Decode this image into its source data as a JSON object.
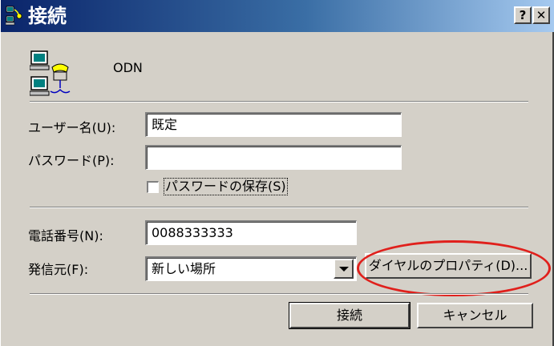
{
  "window": {
    "title": "接続",
    "help_label": "?",
    "close_label": "✕"
  },
  "connection": {
    "name": "ODN",
    "icon": "dialup-connection-icon"
  },
  "fields": {
    "username": {
      "label": "ユーザー名(U):",
      "value": "既定"
    },
    "password": {
      "label": "パスワード(P):",
      "value": ""
    },
    "save_password": {
      "label": "パスワードの保存(S)",
      "checked": false
    },
    "phone": {
      "label": "電話番号(N):",
      "value": "0088333333"
    },
    "dial_from": {
      "label": "発信元(F):",
      "value": "新しい場所"
    }
  },
  "buttons": {
    "dialing_properties": "ダイヤルのプロパティ(D)...",
    "connect": "接続",
    "cancel": "キャンセル"
  },
  "colors": {
    "annotation": "#e0201c",
    "titlebar": "#0a246a",
    "face": "#d4d0c8"
  }
}
